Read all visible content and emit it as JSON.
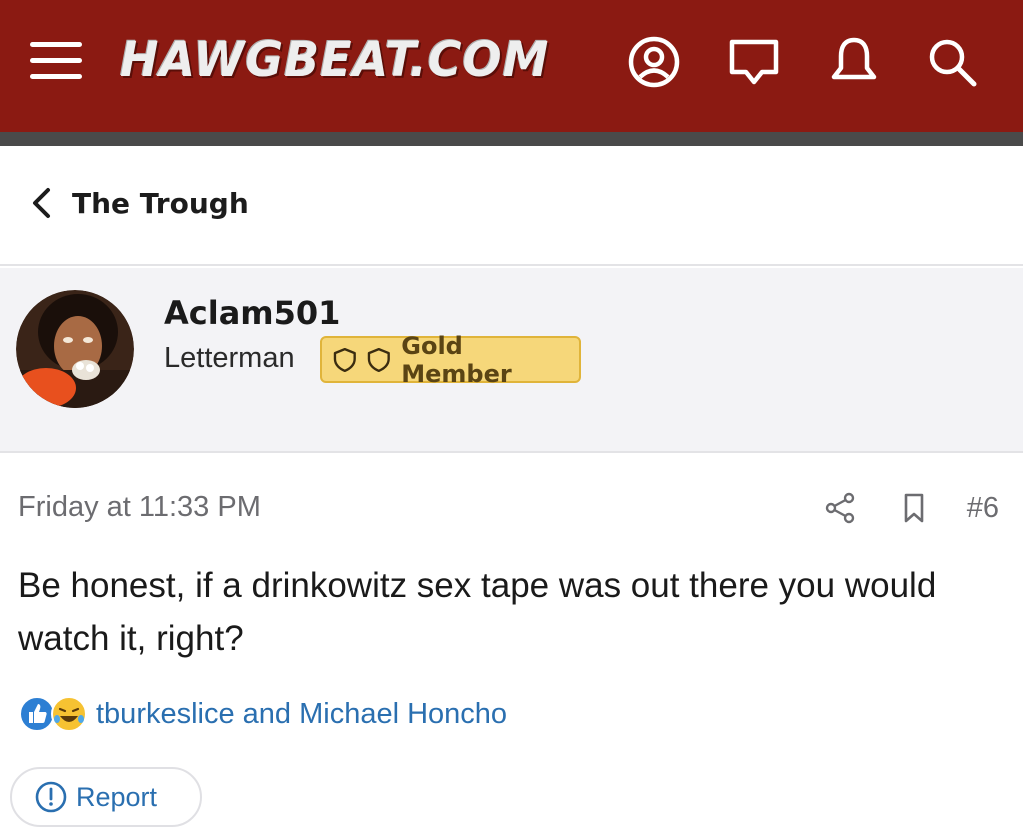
{
  "header": {
    "site_name": "HAWGBEAT.COM",
    "colors": {
      "bar": "#8b1a12",
      "stripe": "#4a4a4a"
    },
    "icons": [
      "menu-icon",
      "account-icon",
      "messages-icon",
      "notifications-icon",
      "search-icon"
    ]
  },
  "breadcrumb": {
    "label": "The Trough",
    "icon": "chevron-left-icon"
  },
  "user": {
    "username": "Aclam501",
    "title": "Letterman",
    "badge": {
      "label": "Gold Member",
      "icons": [
        "shield-icon",
        "shield-icon"
      ],
      "color": "#f6d77a"
    }
  },
  "post": {
    "timestamp": "Friday at 11:33 PM",
    "number": "#6",
    "body": "Be honest, if a drinkowitz sex tape was out there you would watch it, right?",
    "reactions": {
      "icons": [
        "like-reaction-icon",
        "laugh-reaction-icon"
      ],
      "users": "tburkeslice and Michael Honcho"
    },
    "report_label": "Report"
  }
}
